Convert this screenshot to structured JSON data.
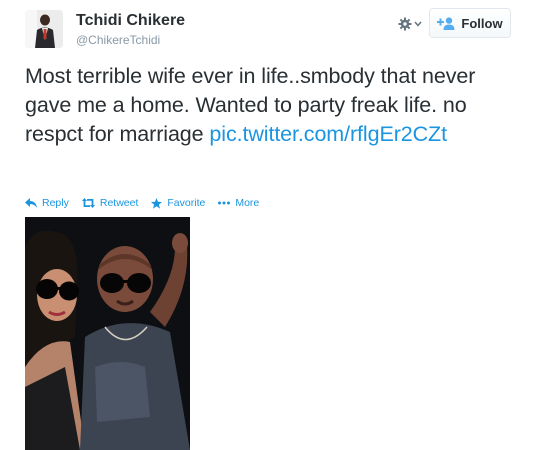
{
  "user": {
    "name": "Tchidi Chikere",
    "handle": "@ChikereTchidi",
    "avatar_icon": "profile-avatar"
  },
  "header": {
    "settings_icon": "gear-icon",
    "follow_label": "Follow",
    "follow_icon": "add-person-icon"
  },
  "tweet": {
    "text": "Most terrible wife ever in life..smbody that never gave me a home. Wanted to party freak life. no respct for marriage",
    "link": "pic.twitter.com/rflgEr2CZt"
  },
  "actions": {
    "reply": "Reply",
    "retweet": "Retweet",
    "favorite": "Favorite",
    "more": "More"
  },
  "colors": {
    "link": "#1b95e0",
    "text": "#292f33",
    "muted": "#8899a6"
  }
}
